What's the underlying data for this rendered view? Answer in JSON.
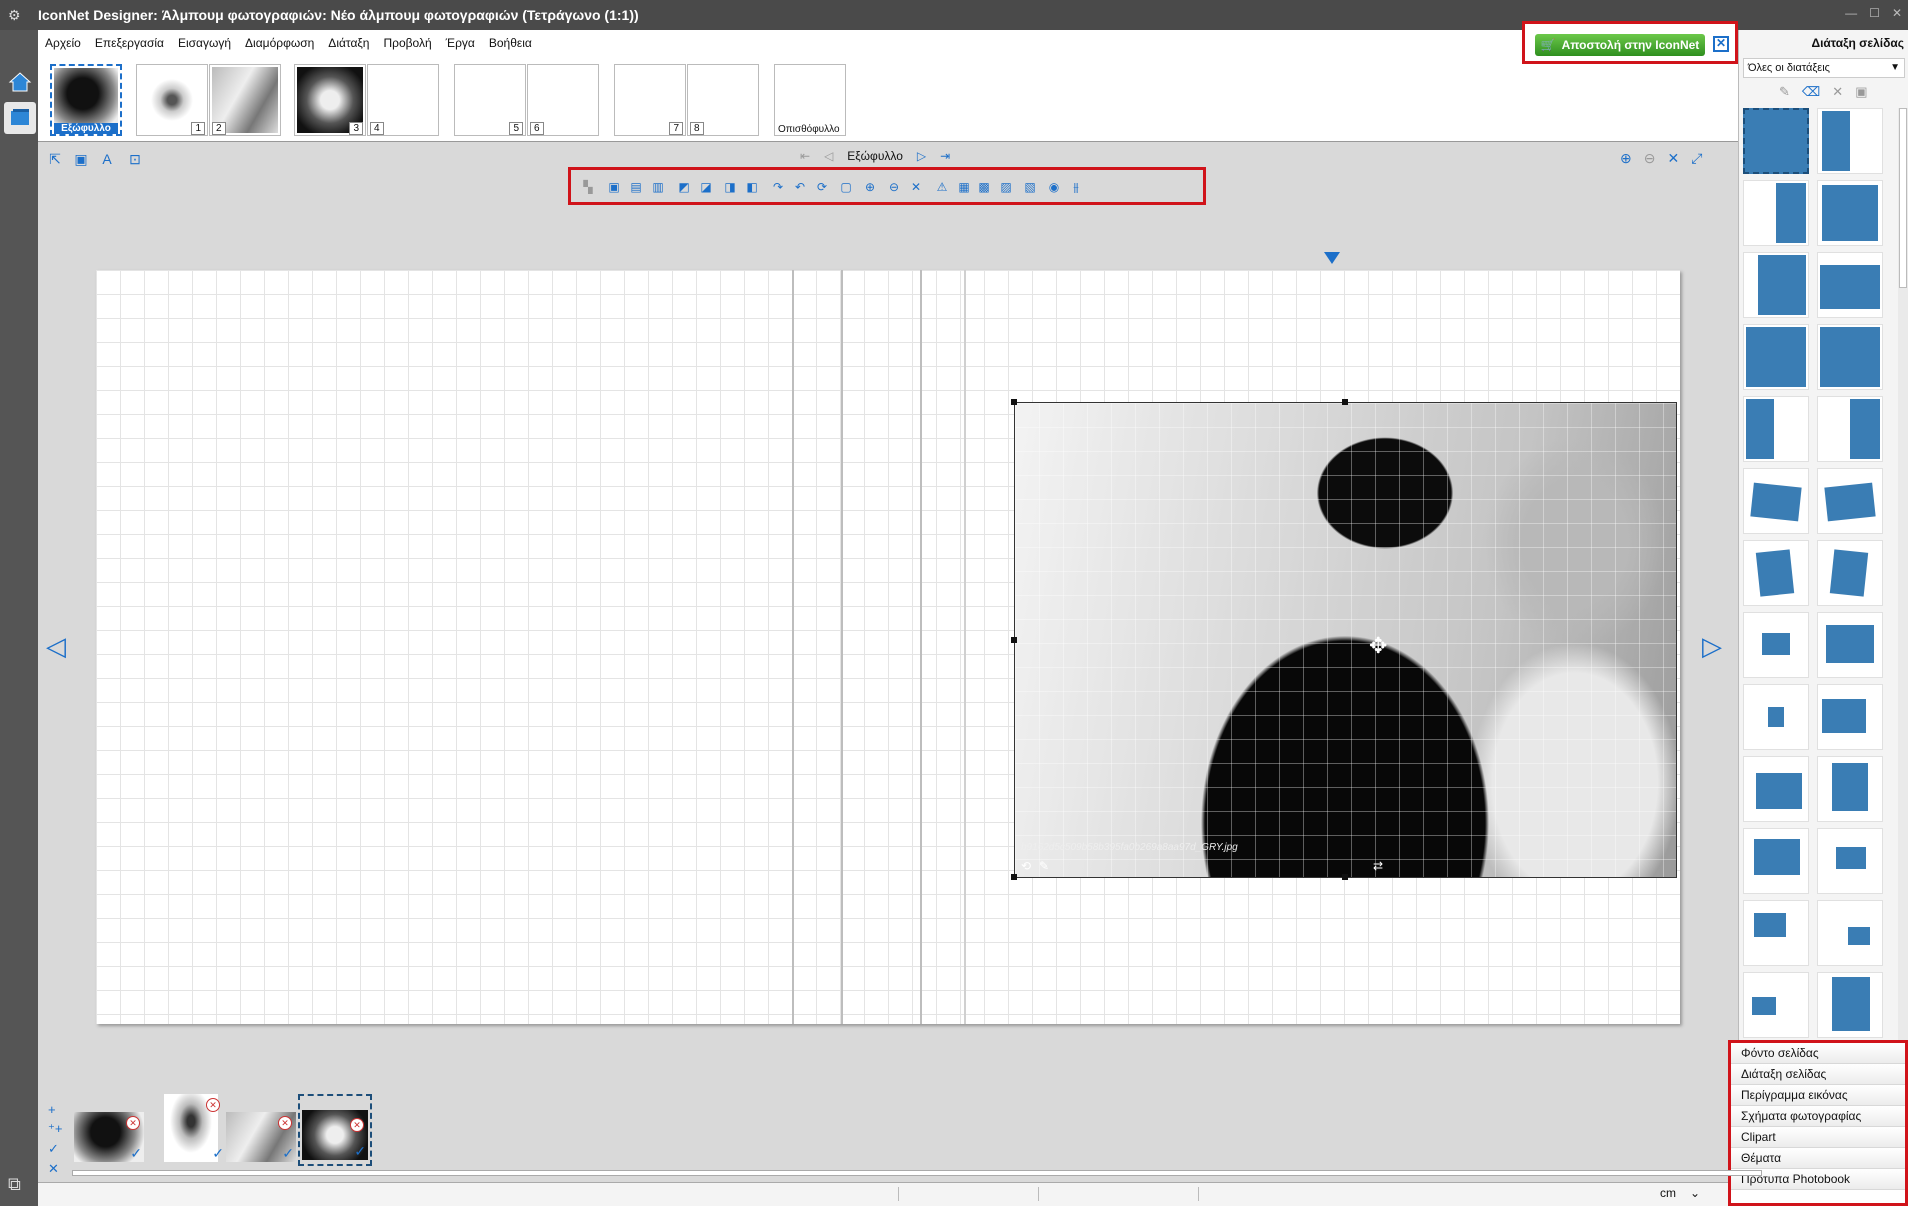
{
  "window": {
    "title": "IconNet Designer: Άλμπουμ φωτογραφιών: Νέο άλμπουμ φωτογραφιών (Τετράγωνο (1:1))"
  },
  "menu": [
    "Αρχείο",
    "Επεξεργασία",
    "Εισαγωγή",
    "Διαμόρφωση",
    "Διάταξη",
    "Προβολή",
    "Έργα",
    "Βοήθεια"
  ],
  "send_button": {
    "label": "Αποστολή στην IconNet"
  },
  "pages": {
    "cover_label": "Εξώφυλλο",
    "numbers": [
      "1",
      "2",
      "3",
      "4",
      "5",
      "6",
      "7",
      "8"
    ],
    "back_label": "Οπισθόφυλλο"
  },
  "page_nav": {
    "current": "Εξώφυλλο"
  },
  "photo": {
    "filename": "b9162d5c509b58b395fa0b269a8aa97d_GRY.jpg"
  },
  "right_panel": {
    "title": "Διάταξη σελίδας",
    "filter": "Όλες οι διατάξεις",
    "accordion": [
      "Φόντο σελίδας",
      "Διάταξη σελίδας",
      "Περίγραμμα εικόνας",
      "Σχήματα φωτογραφίας",
      "Clipart",
      "Θέματα",
      "Πρότυπα Photobook"
    ]
  },
  "status": {
    "unit": "cm"
  },
  "colors": {
    "accent": "#1c6fc9",
    "highlight": "#d0131a",
    "layout_tile": "#3a7db4",
    "send_green": "#3fa82a"
  }
}
